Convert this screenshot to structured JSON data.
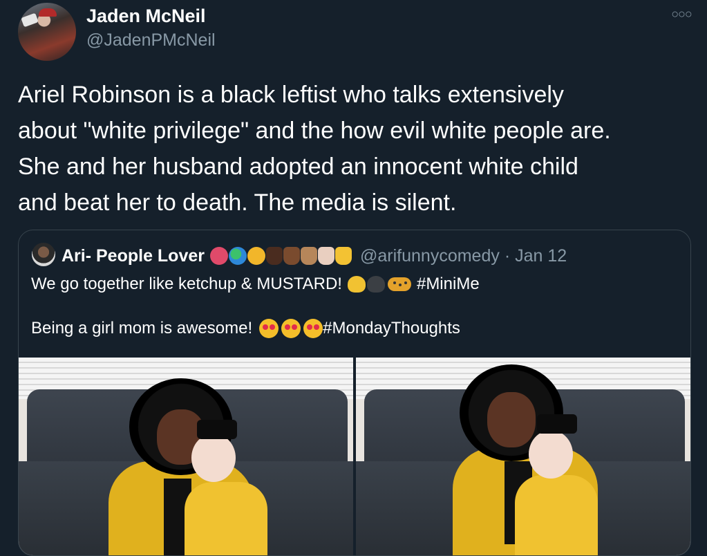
{
  "tweet": {
    "author_name": "Jaden McNeil",
    "author_handle": "@JadenPMcNeil",
    "more_icon": "more-dots-icon",
    "text": "Ariel Robinson is a black leftist who talks extensively\nabout \"white privilege\" and the how evil white people are.\nShe and her husband adopted an innocent white child\nand beat her to death. The media is silent."
  },
  "quote": {
    "author_name": "Ari- People Lover",
    "author_handle": "@arifunnycomedy",
    "date": "· Jan 12",
    "line1_text": "We go together like ketchup & MUSTARD!",
    "line1_hashtag": "#MiniMe",
    "line2_text": "Being a girl mom is awesome!",
    "line2_hashtag": "#MondayThoughts"
  },
  "colors": {
    "background": "#15202b",
    "secondary_text": "#8899a6",
    "border": "#38444d"
  }
}
